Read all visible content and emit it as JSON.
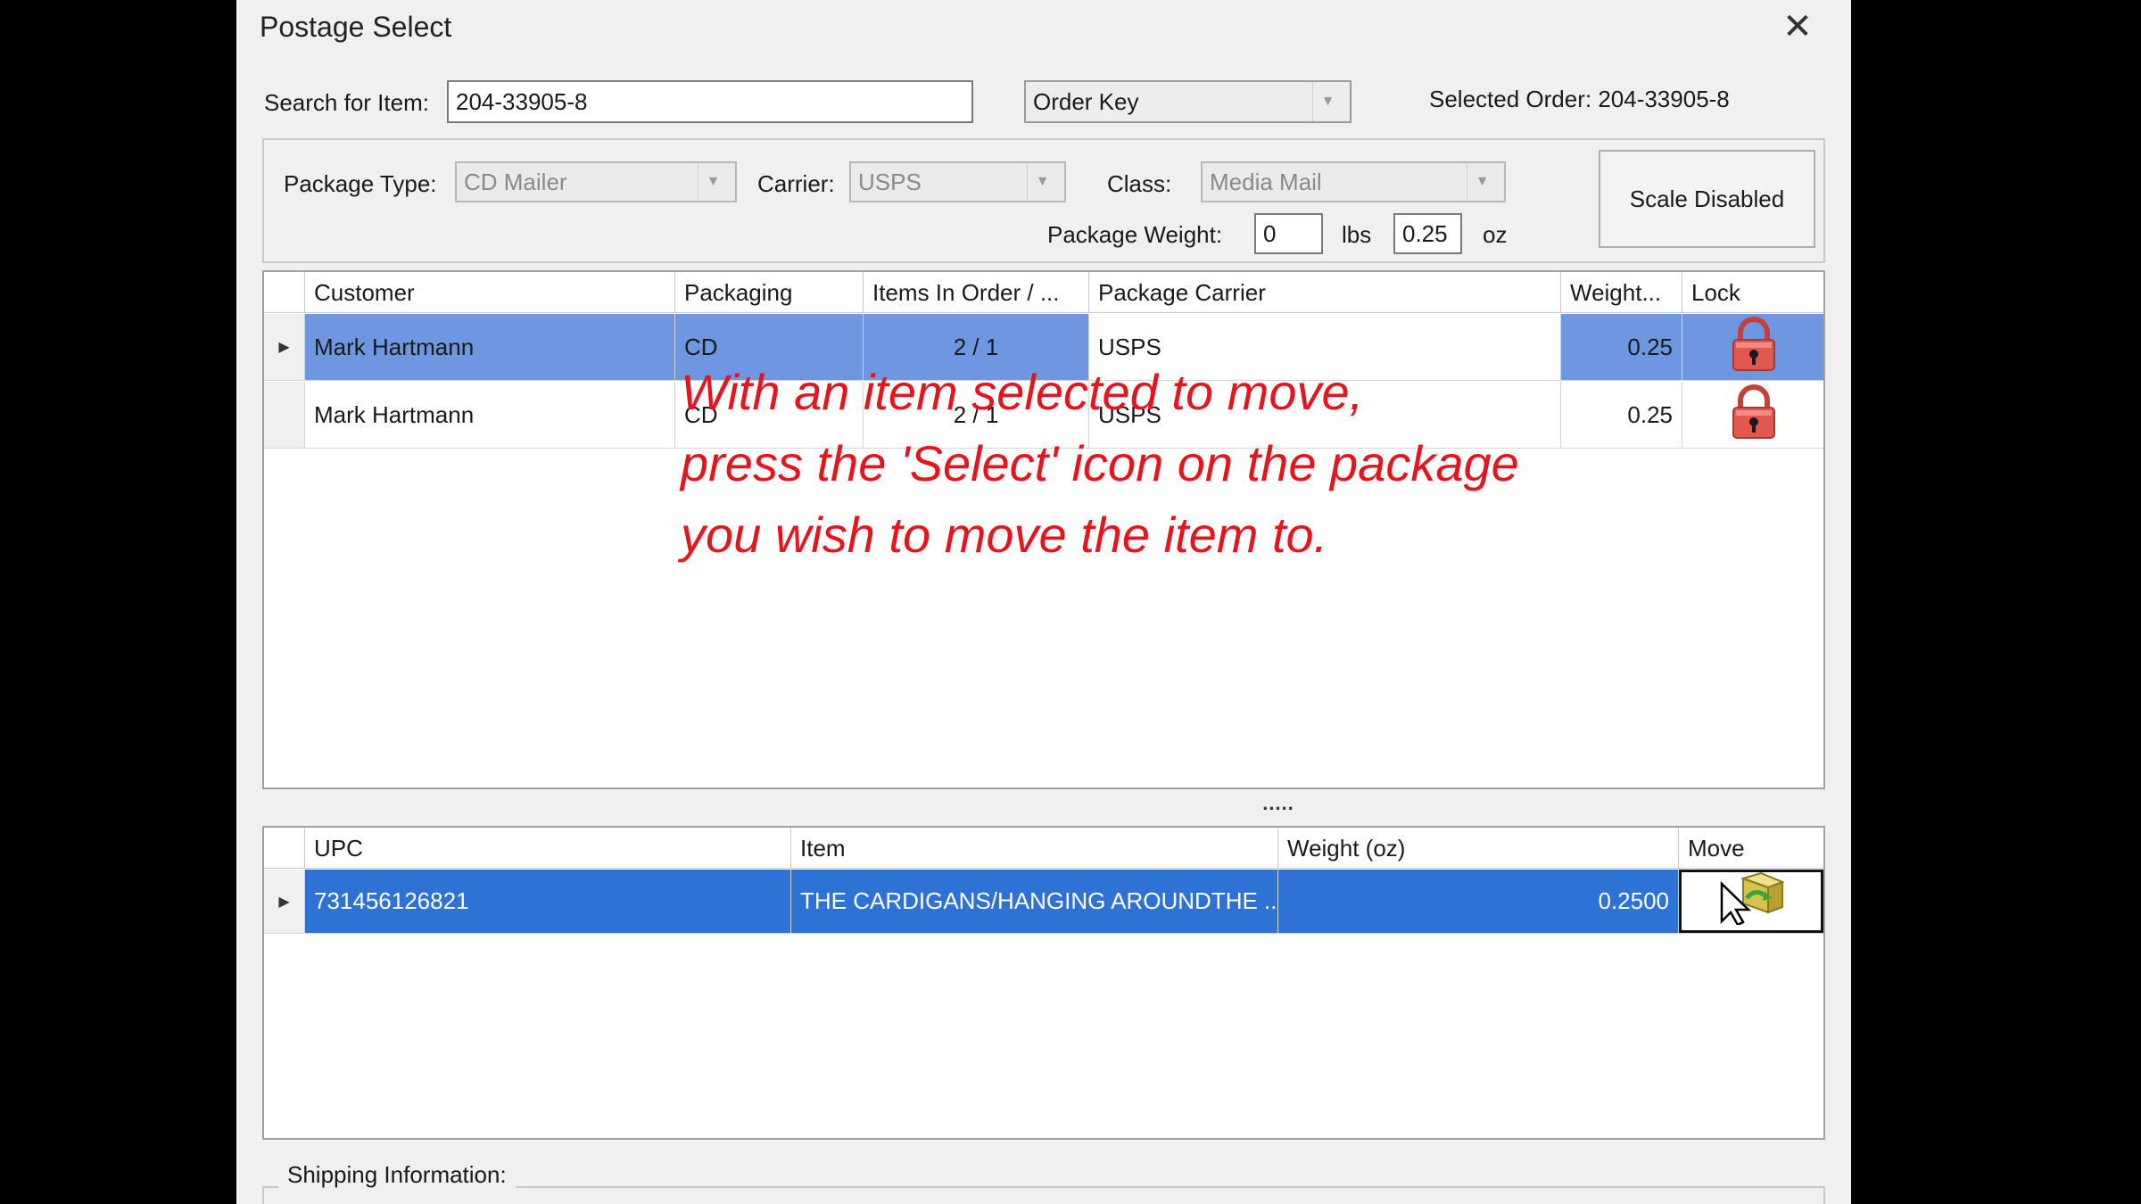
{
  "dialog": {
    "title": "Postage Select"
  },
  "search": {
    "label": "Search for Item:",
    "value": "204-33905-8",
    "mode": "Order Key"
  },
  "selected_order": "Selected Order: 204-33905-8",
  "package": {
    "type_label": "Package Type:",
    "type_value": "CD Mailer",
    "carrier_label": "Carrier:",
    "carrier_value": "USPS",
    "class_label": "Class:",
    "class_value": "Media Mail",
    "weight_label": "Package Weight:",
    "lbs_value": "0",
    "lbs_unit": "lbs",
    "oz_value": "0.25",
    "oz_unit": "oz",
    "scale_button": "Scale Disabled"
  },
  "packages_table": {
    "columns": [
      "Customer",
      "Packaging",
      "Items In Order / ...",
      "Package Carrier",
      "Weight...",
      "Lock"
    ],
    "rows": [
      {
        "customer": "Mark Hartmann",
        "packaging": "CD",
        "items": "2 / 1",
        "carrier": "USPS",
        "weight": "0.25",
        "lock_icon": "padlock-icon"
      },
      {
        "customer": "Mark Hartmann",
        "packaging": "CD",
        "items": "2 / 1",
        "carrier": "USPS",
        "weight": "0.25",
        "lock_icon": "padlock-icon"
      }
    ]
  },
  "caption": {
    "line1": "With an item selected to move,",
    "line2": "press the 'Select' icon on the package",
    "line3": "you wish to move the item to."
  },
  "splitter": ".....",
  "items_table": {
    "columns": [
      "UPC",
      "Item",
      "Weight (oz)",
      "Move"
    ],
    "rows": [
      {
        "upc": "731456126821",
        "item": "THE CARDIGANS/HANGING AROUNDTHE ...",
        "weight": "0.2500",
        "move_icon": "move-package-icon"
      }
    ]
  },
  "shipping": {
    "label": "Shipping Information:"
  },
  "colors": {
    "selection_light": "#6f96e0",
    "selection_dark": "#2f72d6",
    "caption": "#e8141c",
    "lock_icon": "#d9534f"
  }
}
